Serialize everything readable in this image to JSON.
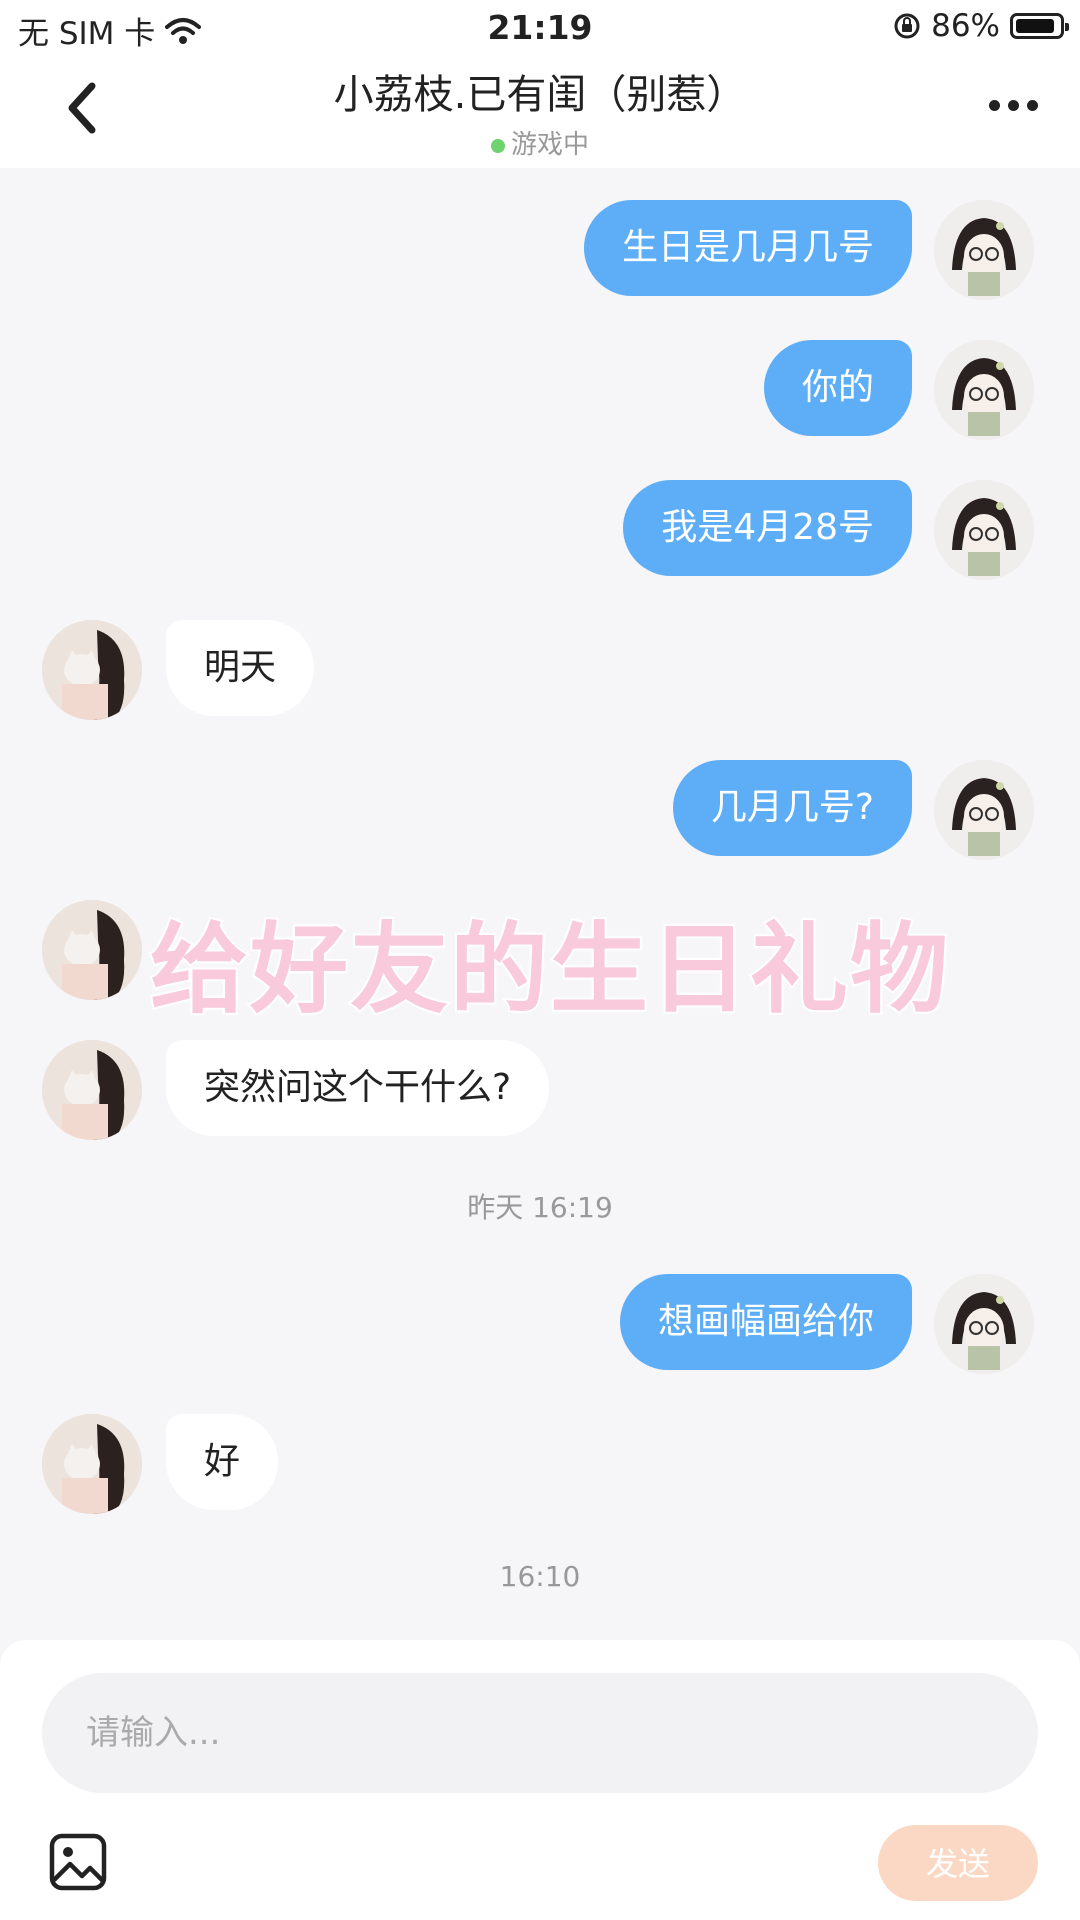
{
  "status": {
    "carrier": "无 SIM 卡",
    "time": "21:19",
    "battery": "86%"
  },
  "header": {
    "title": "小荔枝.已有闺（别惹）",
    "status": "游戏中"
  },
  "messages": [
    {
      "from": "me",
      "text": "生日是几月几号"
    },
    {
      "from": "me",
      "text": "你的"
    },
    {
      "from": "me",
      "text": "我是4月28号"
    },
    {
      "from": "her",
      "text": "明天"
    },
    {
      "from": "me",
      "text": "几月几号?"
    },
    {
      "from": "her",
      "text": ""
    },
    {
      "from": "her",
      "text": "突然问这个干什么?"
    },
    {
      "from": "me",
      "text": "想画幅画给你"
    },
    {
      "from": "her",
      "text": "好"
    }
  ],
  "timestamps": [
    "昨天 16:19",
    "16:10"
  ],
  "watermark": "给好友的生日礼物",
  "composer": {
    "placeholder": "请输入...",
    "send_label": "发送"
  },
  "colors": {
    "my_bubble": "#5eaef7",
    "her_bubble": "#ffffff",
    "send_button": "#fbd8c4",
    "online_dot": "#6ed36e"
  }
}
